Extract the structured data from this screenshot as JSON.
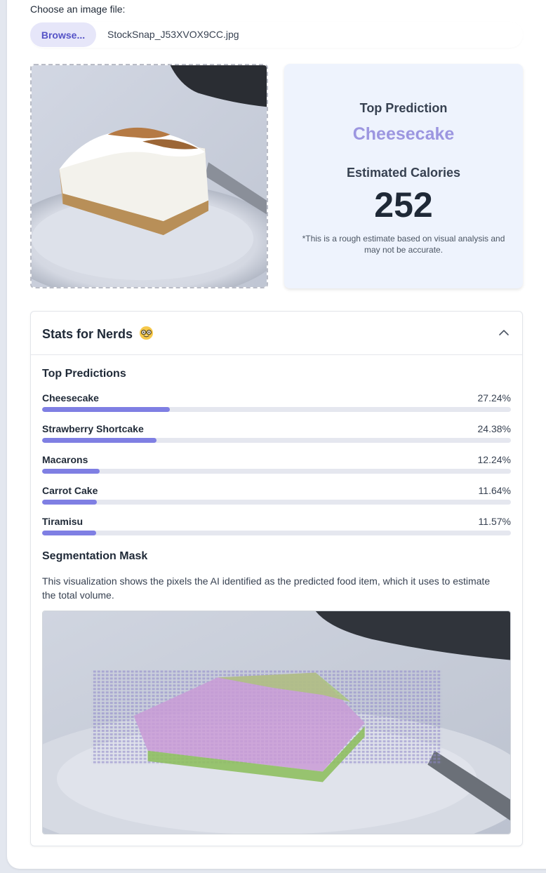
{
  "upload": {
    "label": "Choose an image file:",
    "browse_label": "Browse...",
    "file_name": "StockSnap_J53XVOX9CC.jpg"
  },
  "prediction": {
    "title": "Top Prediction",
    "name": "Cheesecake",
    "calories_title": "Estimated Calories",
    "calories": "252",
    "disclaimer": "*This is a rough estimate based on visual analysis and may not be accurate."
  },
  "stats": {
    "title": "Stats for Nerds",
    "emoji_icon": "nerd-face-icon",
    "top_predictions_title": "Top Predictions",
    "predictions": [
      {
        "label": "Cheesecake",
        "percent": "27.24%",
        "value": 27.24
      },
      {
        "label": "Strawberry Shortcake",
        "percent": "24.38%",
        "value": 24.38
      },
      {
        "label": "Macarons",
        "percent": "12.24%",
        "value": 12.24
      },
      {
        "label": "Carrot Cake",
        "percent": "11.64%",
        "value": 11.64
      },
      {
        "label": "Tiramisu",
        "percent": "11.57%",
        "value": 11.57
      }
    ],
    "segmentation_title": "Segmentation Mask",
    "segmentation_desc": "This visualization shows the pixels the AI identified as the predicted food item, which it uses to estimate the total volume."
  },
  "colors": {
    "accent": "#7f7fe3",
    "prediction_name": "#9c96e0",
    "card_bg": "#eef3fd"
  }
}
